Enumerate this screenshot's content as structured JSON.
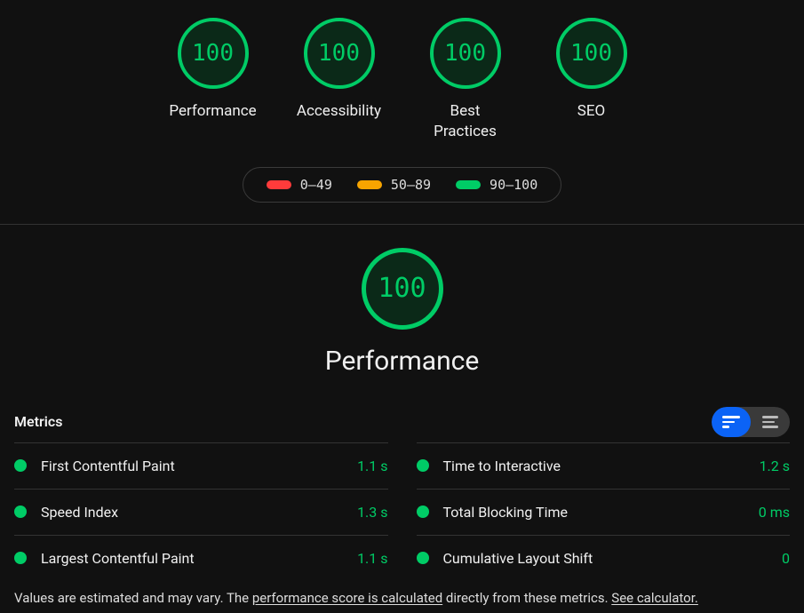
{
  "gauges": [
    {
      "score": "100",
      "label": "Performance"
    },
    {
      "score": "100",
      "label": "Accessibility"
    },
    {
      "score": "100",
      "label": "Best Practices"
    },
    {
      "score": "100",
      "label": "SEO"
    }
  ],
  "legend": {
    "red": "0–49",
    "orange": "50–89",
    "green": "90–100"
  },
  "performance": {
    "score": "100",
    "title": "Performance"
  },
  "metrics_heading": "Metrics",
  "metrics_left": [
    {
      "name": "First Contentful Paint",
      "value": "1.1 s"
    },
    {
      "name": "Speed Index",
      "value": "1.3 s"
    },
    {
      "name": "Largest Contentful Paint",
      "value": "1.1 s"
    }
  ],
  "metrics_right": [
    {
      "name": "Time to Interactive",
      "value": "1.2 s"
    },
    {
      "name": "Total Blocking Time",
      "value": "0 ms"
    },
    {
      "name": "Cumulative Layout Shift",
      "value": "0"
    }
  ],
  "footnote": {
    "a": "Values are estimated and may vary. The ",
    "link1": "performance score is calculated",
    "b": " directly from these metrics. ",
    "link2": "See calculator."
  }
}
